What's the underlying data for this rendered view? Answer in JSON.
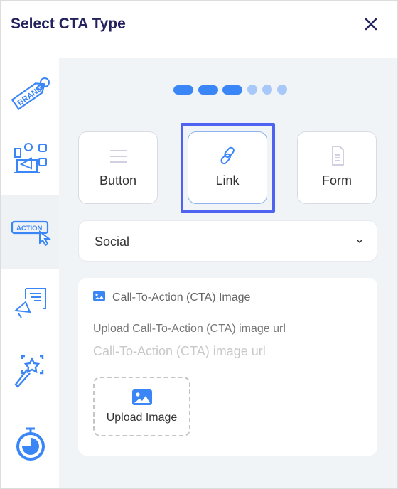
{
  "header": {
    "title": "Select CTA Type",
    "close_icon": "close-icon"
  },
  "sidebar": {
    "items": [
      {
        "icon": "brand-tag-icon",
        "label": "BRAND"
      },
      {
        "icon": "social-media-megaphone-icon"
      },
      {
        "icon": "action-cursor-icon",
        "label": "ACTION",
        "selected": true
      },
      {
        "icon": "announcement-megaphone-icon"
      },
      {
        "icon": "magic-wand-icon"
      },
      {
        "icon": "stopwatch-icon"
      }
    ]
  },
  "stepper": {
    "total": 6,
    "completed": 3,
    "colors": {
      "active": "#3a86f7",
      "inactive": "#a8c8fa"
    }
  },
  "types": [
    {
      "label": "Button",
      "icon": "lines-icon"
    },
    {
      "label": "Link",
      "icon": "link-icon",
      "selected": true
    },
    {
      "label": "Form",
      "icon": "document-icon"
    }
  ],
  "dropdown": {
    "value": "Social"
  },
  "cta_image": {
    "heading": "Call-To-Action (CTA) Image",
    "url_label": "Upload Call-To-Action (CTA) image url",
    "url_placeholder": "Call-To-Action (CTA) image url",
    "url_value": "",
    "upload_label": "Upload Image"
  },
  "colors": {
    "accent": "#3a86f7",
    "highlight": "#4e63f2",
    "title": "#23225e"
  }
}
